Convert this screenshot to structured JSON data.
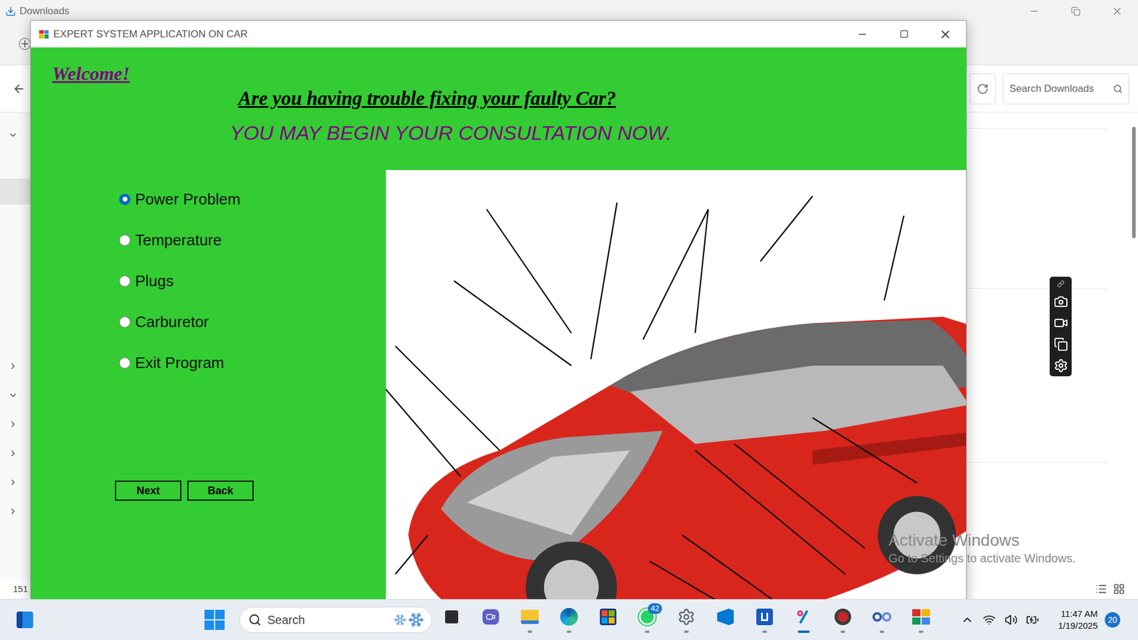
{
  "explorer": {
    "title": "Downloads",
    "search_placeholder": "Search Downloads",
    "status": "151",
    "sidebar": {
      "top": [
        {
          "has_children": true,
          "expanded": true,
          "selected": false
        },
        {
          "has_children": false,
          "expanded": false,
          "selected": true
        }
      ],
      "tree": [
        {
          "has_children": true,
          "expanded": false,
          "selected": false
        },
        {
          "has_children": true,
          "expanded": true,
          "selected": false
        },
        {
          "has_children": true,
          "expanded": false,
          "selected": false
        },
        {
          "has_children": true,
          "expanded": false,
          "selected": false
        },
        {
          "has_children": true,
          "expanded": false,
          "selected": false
        },
        {
          "has_children": true,
          "expanded": false,
          "selected": false
        }
      ]
    }
  },
  "window": {
    "title": "EXPERT SYSTEM APPLICATION ON CAR"
  },
  "welcome": "Welcome!",
  "heading": "Are you having trouble fixing your faulty Car?",
  "subheading": "YOU MAY BEGIN YOUR CONSULTATION NOW.",
  "options": [
    {
      "label": "Power Problem",
      "selected": true
    },
    {
      "label": "Temperature",
      "selected": false
    },
    {
      "label": "Plugs",
      "selected": false
    },
    {
      "label": "Carburetor",
      "selected": false
    },
    {
      "label": "Exit Program",
      "selected": false
    }
  ],
  "buttons": [
    "Next",
    "Back"
  ],
  "watermark": {
    "title": "Activate Windows",
    "subtitle": "Go to Settings to activate Windows."
  },
  "taskbar": {
    "search": "Search",
    "apps": [
      {
        "running": false,
        "active": false
      },
      {
        "running": false,
        "active": false
      },
      {
        "running": true,
        "active": false
      },
      {
        "running": true,
        "active": false
      },
      {
        "running": false,
        "active": false
      },
      {
        "running": true,
        "active": false,
        "badge": "42"
      },
      {
        "running": true,
        "active": false
      },
      {
        "running": false,
        "active": false
      },
      {
        "running": true,
        "active": false
      },
      {
        "running": true,
        "active": true
      },
      {
        "running": true,
        "active": false
      },
      {
        "running": true,
        "active": false
      },
      {
        "running": true,
        "active": false
      }
    ],
    "time": "11:47 AM",
    "date": "1/19/2025",
    "notifications": "20"
  }
}
